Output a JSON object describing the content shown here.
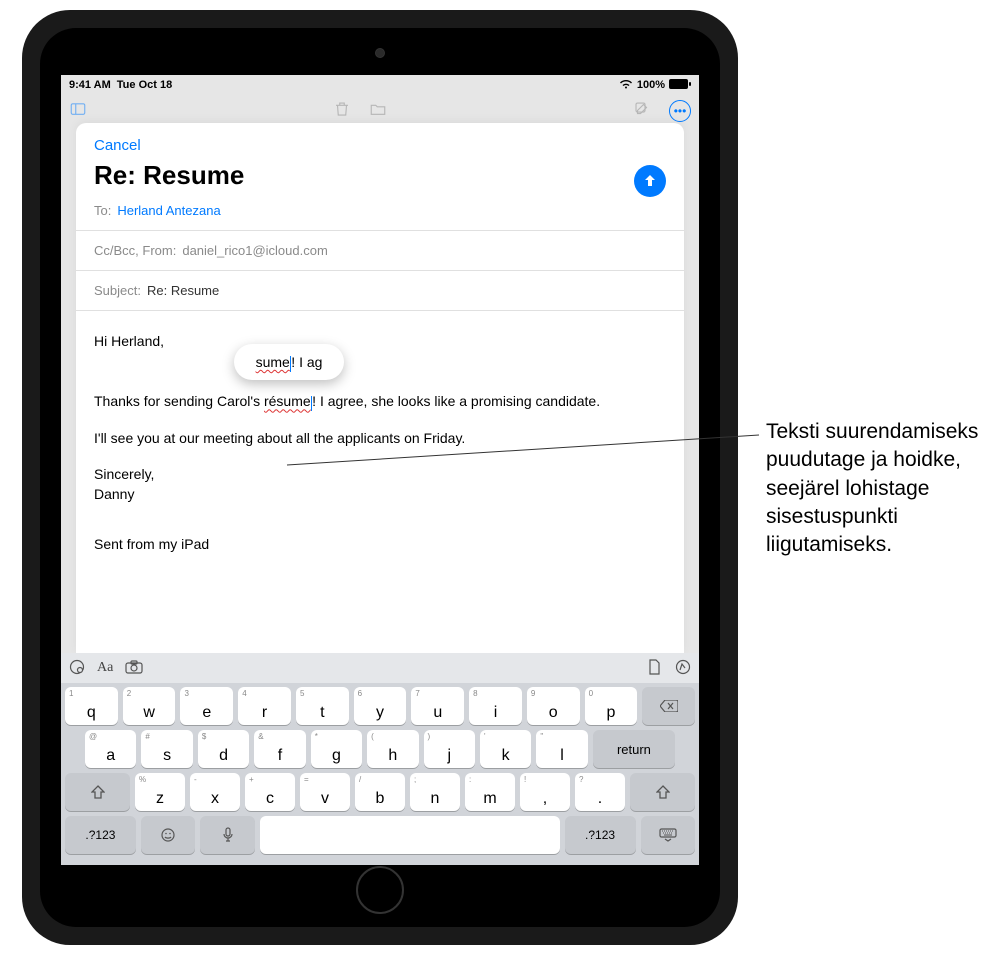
{
  "status": {
    "time": "9:41 AM",
    "date": "Tue Oct 18",
    "battery": "100%"
  },
  "compose": {
    "cancel": "Cancel",
    "subject_large": "Re: Resume",
    "to_label": "To:",
    "to_value": "Herland Antezana",
    "ccbcc_label": "Cc/Bcc, From:",
    "from_value": "daniel_rico1@icloud.com",
    "subject_label": "Subject:",
    "subject_value": "Re: Resume"
  },
  "body": {
    "greeting": "Hi Herland,",
    "loupe_text_before": "sume",
    "loupe_text_after": "! I ag",
    "p1_before": "Thanks for sending Carol's ",
    "p1_word": "résume",
    "p1_after": "! I agree, she looks like a promising candidate.",
    "p2": "I'll see you at our meeting about all the applicants on Friday.",
    "closing1": "Sincerely,",
    "closing2": "Danny",
    "signature": "Sent from my iPad"
  },
  "keyboard": {
    "row1": [
      {
        "main": "q",
        "alt": "1"
      },
      {
        "main": "w",
        "alt": "2"
      },
      {
        "main": "e",
        "alt": "3"
      },
      {
        "main": "r",
        "alt": "4"
      },
      {
        "main": "t",
        "alt": "5"
      },
      {
        "main": "y",
        "alt": "6"
      },
      {
        "main": "u",
        "alt": "7"
      },
      {
        "main": "i",
        "alt": "8"
      },
      {
        "main": "o",
        "alt": "9"
      },
      {
        "main": "p",
        "alt": "0"
      }
    ],
    "row2": [
      {
        "main": "a",
        "alt": "@"
      },
      {
        "main": "s",
        "alt": "#"
      },
      {
        "main": "d",
        "alt": "$"
      },
      {
        "main": "f",
        "alt": "&"
      },
      {
        "main": "g",
        "alt": "*"
      },
      {
        "main": "h",
        "alt": "("
      },
      {
        "main": "j",
        "alt": ")"
      },
      {
        "main": "k",
        "alt": "'"
      },
      {
        "main": "l",
        "alt": "\""
      }
    ],
    "row3": [
      {
        "main": "z",
        "alt": "%"
      },
      {
        "main": "x",
        "alt": "-"
      },
      {
        "main": "c",
        "alt": "+"
      },
      {
        "main": "v",
        "alt": "="
      },
      {
        "main": "b",
        "alt": "/"
      },
      {
        "main": "n",
        "alt": ";"
      },
      {
        "main": "m",
        "alt": ":"
      },
      {
        "main": ",",
        "alt": "!"
      },
      {
        "main": ".",
        "alt": "?"
      }
    ],
    "return": "return",
    "numswitch": ".?123"
  },
  "callout": "Teksti suurendamiseks puudutage ja hoidke, seejärel lohistage sisestuspunkti liigutamiseks."
}
